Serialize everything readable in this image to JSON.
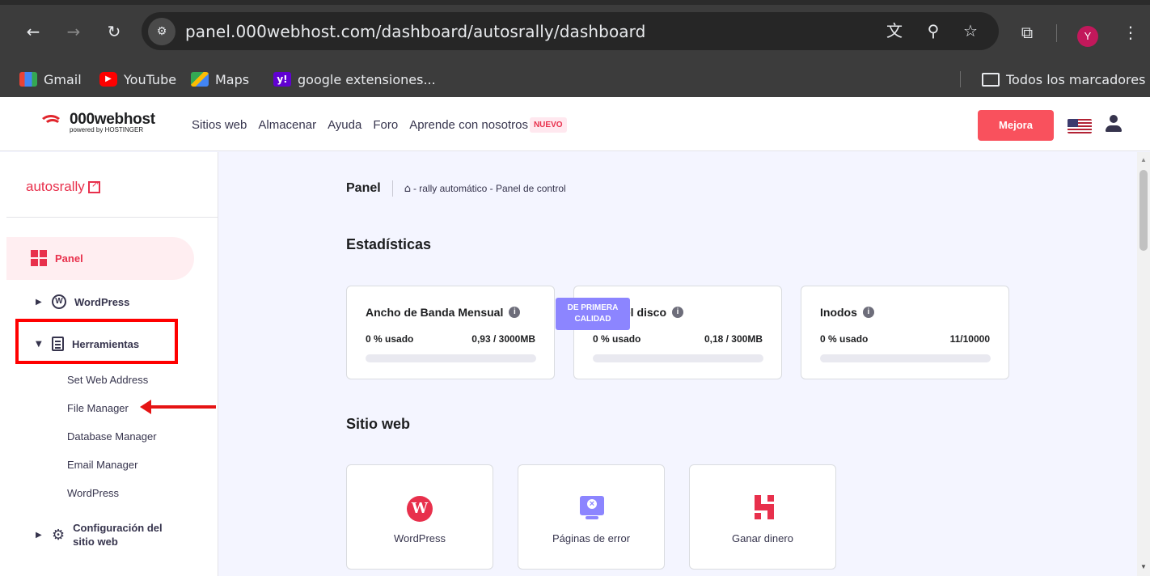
{
  "browser": {
    "url": "panel.000webhost.com/dashboard/autosrally/dashboard",
    "profile_initial": "Y",
    "bookmarks": [
      {
        "label": "Gmail",
        "icon": "gmail-icon"
      },
      {
        "label": "YouTube",
        "icon": "youtube-icon"
      },
      {
        "label": "Maps",
        "icon": "maps-icon"
      },
      {
        "label": "google extensiones...",
        "icon": "yahoo-icon"
      }
    ],
    "all_bookmarks": "Todos los marcadores"
  },
  "header": {
    "logo_name": "000webhost",
    "logo_sub": "powered by HOSTINGER",
    "nav": [
      "Sitios web",
      "Almacenar",
      "Ayuda",
      "Foro",
      "Aprende con nosotros"
    ],
    "nuevo_badge": "NUEVO",
    "upgrade_label": "Mejora"
  },
  "sidebar": {
    "site_name": "autosrally",
    "items": {
      "panel": "Panel",
      "wordpress": "WordPress",
      "tools": "Herramientas",
      "tools_sub": [
        "Set Web Address",
        "File Manager",
        "Database Manager",
        "Email Manager",
        "WordPress"
      ],
      "config_line1": "Configuración del",
      "config_line2": "sitio web"
    }
  },
  "main": {
    "page_title": "Panel",
    "breadcrumb": "- rally automático - Panel de control",
    "stats_title": "Estadísticas",
    "stats": [
      {
        "title": "Ancho de Banda Mensual",
        "used": "0 % usado",
        "value": "0,93 / 3000MB",
        "fraction": 0
      },
      {
        "title": "Uso del disco",
        "used": "0 % usado",
        "value": "0,18 / 300MB",
        "fraction": 0
      },
      {
        "title": "Inodos",
        "used": "0 % usado",
        "value": "11/10000",
        "fraction": 0
      }
    ],
    "website_title": "Sitio web",
    "premium_badge_line1": "DE PRIMERA",
    "premium_badge_line2": "CALIDAD",
    "website_cards": [
      {
        "label": "WordPress",
        "icon": "wordpress-icon"
      },
      {
        "label": "Páginas de error",
        "icon": "error-page-icon"
      },
      {
        "label": "Ganar dinero",
        "icon": "hostinger-icon"
      }
    ]
  },
  "colors": {
    "accent": "#e8304c",
    "annotation": "#ff0000",
    "premium": "#8c85ff"
  }
}
